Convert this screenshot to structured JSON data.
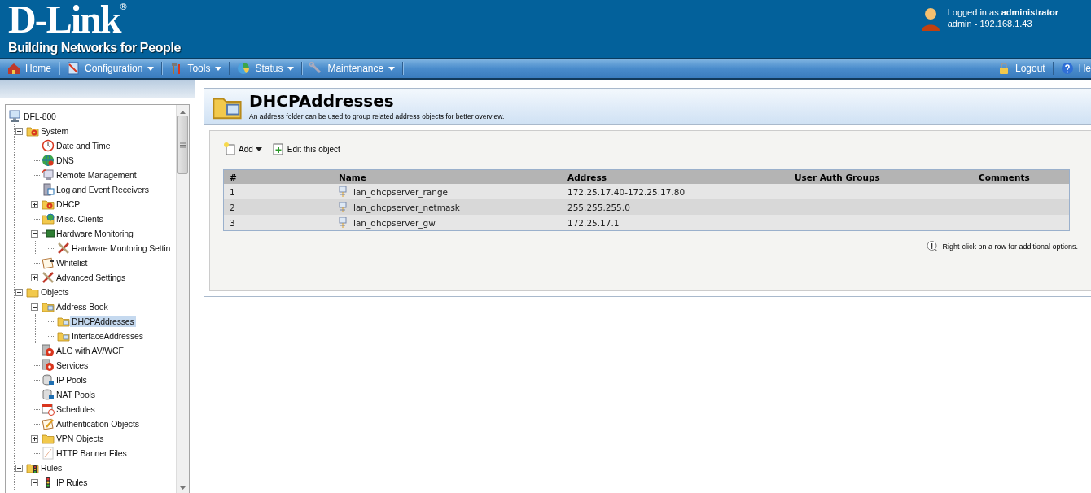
{
  "header": {
    "logo": {
      "brand": "D-Link",
      "mark": "®",
      "tagline": "Building Networks for People"
    },
    "user": {
      "line_1": "Logged in as **administrator**",
      "line_2": "admin - 192.168.1.43"
    }
  },
  "menu_bar": {
    "items": [
      {
        "label": "Home",
        "kind": "home",
        "dropdown": false
      },
      {
        "label": "Configuration",
        "kind": "config",
        "dropdown": true
      },
      {
        "label": "Tools",
        "kind": "tools",
        "dropdown": true
      },
      {
        "label": "Status",
        "kind": "status",
        "dropdown": true
      },
      {
        "label": "Maintenance",
        "kind": "wrench",
        "dropdown": true
      }
    ],
    "right_items": [
      {
        "label": "Logout",
        "kind": "lock",
        "dropdown": false
      },
      {
        "label": "He",
        "kind": "help",
        "dropdown": false
      }
    ]
  },
  "sidebar": {
    "tree": [
      {
        "label": "DFL-800",
        "kind": "computer",
        "selected": false,
        "children": [
          {
            "label": "System",
            "kind": "folder-gear",
            "expanded": true,
            "selected": false,
            "children": [
              {
                "label": "Date and Time",
                "kind": "clock",
                "selected": false
              },
              {
                "label": "DNS",
                "kind": "globe",
                "selected": false
              },
              {
                "label": "Remote Management",
                "kind": "monitor",
                "selected": false
              },
              {
                "label": "Log and Event Receivers",
                "kind": "server",
                "selected": false
              },
              {
                "label": "DHCP",
                "kind": "folder-gear",
                "expanded": false,
                "selected": false
              },
              {
                "label": "Misc. Clients",
                "kind": "folder-globe",
                "selected": false
              },
              {
                "label": "Hardware Monitoring",
                "kind": "circuit",
                "expanded": true,
                "selected": false,
                "children": [
                  {
                    "label": "Hardware Montoring Settin",
                    "kind": "tools",
                    "selected": false
                  }
                ]
              },
              {
                "label": "Whitelist",
                "kind": "note",
                "selected": false
              },
              {
                "label": "Advanced Settings",
                "kind": "tools",
                "expanded": false,
                "selected": false
              }
            ]
          },
          {
            "label": "Objects",
            "kind": "folder",
            "expanded": true,
            "selected": false,
            "children": [
              {
                "label": "Address Book",
                "kind": "folder-net",
                "expanded": true,
                "selected": false,
                "children": [
                  {
                    "label": "DHCPAddresses",
                    "kind": "folder-net",
                    "selected": true
                  },
                  {
                    "label": "InterfaceAddresses",
                    "kind": "folder-net",
                    "selected": false
                  }
                ]
              },
              {
                "label": "ALG with AV/WCF",
                "kind": "gear",
                "selected": false
              },
              {
                "label": "Services",
                "kind": "gear",
                "selected": false
              },
              {
                "label": "IP Pools",
                "kind": "database",
                "selected": false
              },
              {
                "label": "NAT Pools",
                "kind": "database",
                "selected": false
              },
              {
                "label": "Schedules",
                "kind": "calendar",
                "selected": false
              },
              {
                "label": "Authentication Objects",
                "kind": "pen",
                "selected": false
              },
              {
                "label": "VPN Objects",
                "kind": "folder",
                "expanded": false,
                "selected": false
              },
              {
                "label": "HTTP Banner Files",
                "kind": "file",
                "selected": false
              }
            ]
          },
          {
            "label": "Rules",
            "kind": "folder-traffic",
            "expanded": true,
            "selected": false,
            "children": [
              {
                "label": "IP Rules",
                "kind": "traffic",
                "expanded": true,
                "selected": false
              }
            ]
          }
        ]
      }
    ]
  },
  "panel": {
    "title": "DHCPAddresses",
    "subtitle": "An address folder can be used to group related address objects for better overview.",
    "toolbar": [
      {
        "label": "Add",
        "kind": "new",
        "dropdown": true
      },
      {
        "label": "Edit this object",
        "kind": "edit",
        "dropdown": false
      }
    ],
    "table": {
      "columns": [
        "#",
        "Name",
        "Address",
        "User Auth Groups",
        "Comments"
      ],
      "rows": [
        {
          "cells": [
            "1",
            "lan_dhcpserver_range",
            "172.25.17.40-172.25.17.80"
          ]
        },
        {
          "cells": [
            "2",
            "lan_dhcpserver_netmask",
            "255.255.255.0"
          ]
        },
        {
          "cells": [
            "3",
            "lan_dhcpserver_gw",
            "172.25.17.1"
          ]
        }
      ]
    },
    "hint": "Right-click on a row for additional options."
  }
}
